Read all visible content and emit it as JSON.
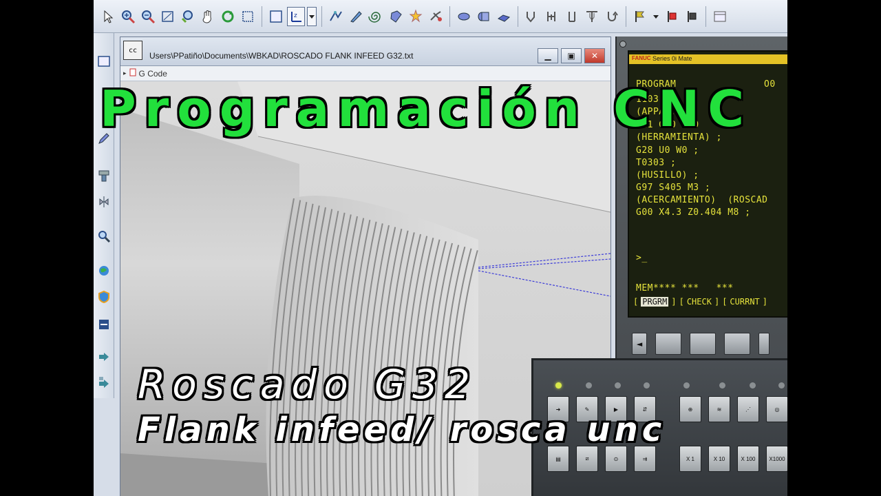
{
  "overlay": {
    "title": "Programación CNC",
    "subtitle_line1": "Roscado G32",
    "subtitle_line2": "Flank infeed/ rosca unc"
  },
  "editor": {
    "cc_label": "cc",
    "file_path": "Users\\PPatiño\\Documents\\WBKAD\\ROSCADO FLANK INFEED G32.txt",
    "gcode_label": "G Code"
  },
  "toolbar": {
    "icons": [
      "select-arrow-icon",
      "zoom-in-icon",
      "zoom-out-icon",
      "zoom-window-icon",
      "zoom-fit-icon",
      "pan-hand-icon",
      "rotate-icon",
      "box-select-icon",
      "view-front-icon",
      "axis-icon",
      "toolpath-icon",
      "tool-icon",
      "spiral-icon",
      "stock-icon",
      "simulate-icon",
      "cut-icon",
      "part-icon",
      "cylinder-icon",
      "fixture-icon",
      "thread-tool-icon",
      "turn-tool-icon",
      "groove-tool-icon",
      "drill-tool-icon",
      "return-icon",
      "flag-icon",
      "save-icon",
      "export-icon"
    ]
  },
  "cnc": {
    "brand": "FANUC",
    "series": "Series 0i Mate",
    "header_left": "PROGRAM",
    "header_right": "O0",
    "lines": [
      "1103 ;",
      "(APPAI...",
      "G21 G20 G70",
      "(HERRAMIENTA) ;",
      "G28 U0 W0 ;",
      "T0303 ;",
      "(HUSILLO) ;",
      "G97 S405 M3 ;",
      "(ACERCAMIENTO)  (ROSCAD",
      "G00 X4.3 Z0.404 M8 ;"
    ],
    "prompt": ">_",
    "mem_line": "MEM**** ***   ***",
    "softkeys": [
      "PRGRM",
      "CHECK",
      "CURRNT"
    ],
    "nav_key": "◄"
  },
  "op_panel": {
    "jog_labels": [
      "X 1",
      "X 10",
      "X 100",
      "X1000"
    ]
  },
  "colors": {
    "title_green": "#22e03c",
    "cnc_text_yellow": "#e6e33c",
    "toolpath_blue": "#3b3bd8"
  }
}
